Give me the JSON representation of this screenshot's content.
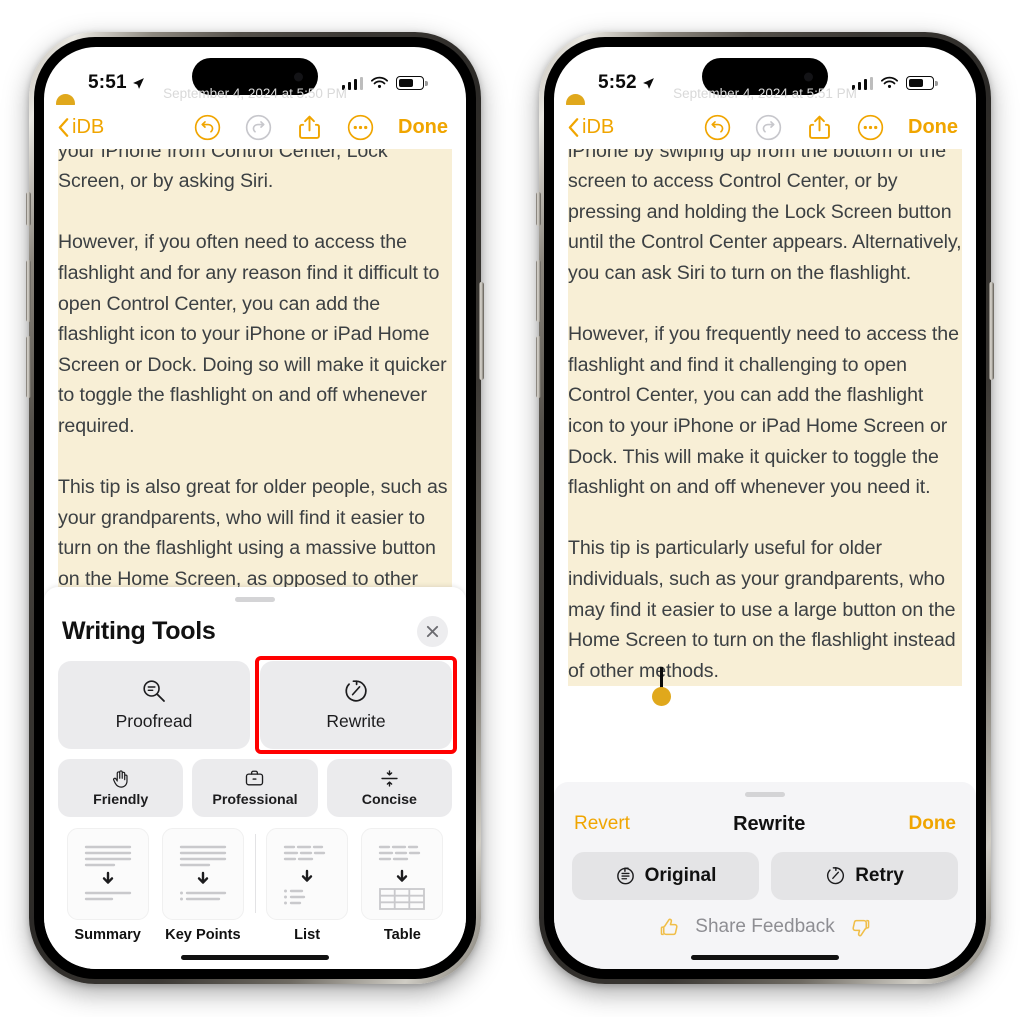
{
  "phones": [
    {
      "id": "left",
      "status": {
        "time": "5:51",
        "location_icon": "location-arrow-icon",
        "cellular_icon": "cellular-signal-icon",
        "wifi_icon": "wifi-icon",
        "battery_icon": "battery-icon"
      },
      "nav": {
        "back_label": "iDB",
        "back_icon": "chevron-left-icon",
        "undo_icon": "undo-icon",
        "redo_icon": "redo-icon",
        "share_icon": "share-icon",
        "more_icon": "more-ellipsis-icon",
        "done_label": "Done"
      },
      "note": {
        "date": "September 4, 2024 at 5:50 PM",
        "paragraphs": [
          "You can easily switch on the flashlight on your iPhone from Control Center, Lock Screen, or by asking Siri.",
          "However, if you often need to access the flashlight and for any reason find it difficult to open Control Center, you can add the flashlight icon to your iPhone or iPad Home Screen or Dock. Doing so will make it quicker to toggle the flashlight on and off whenever required.",
          "This tip is also great for older people, such as your grandparents, who will find it easier to turn on the flashlight using a massive button on the Home Screen, as opposed to other methods."
        ]
      },
      "sheet": {
        "title": "Writing Tools",
        "close_icon": "close-icon",
        "grabber": "sheet-grabber",
        "primary": [
          {
            "label": "Proofread",
            "icon": "proofread-magnifier-icon",
            "highlighted": false
          },
          {
            "label": "Rewrite",
            "icon": "rewrite-clock-icon",
            "highlighted": true
          }
        ],
        "tones": [
          {
            "label": "Friendly",
            "icon": "waving-hand-icon"
          },
          {
            "label": "Professional",
            "icon": "briefcase-icon"
          },
          {
            "label": "Concise",
            "icon": "compress-icon"
          }
        ],
        "formats": [
          {
            "label": "Summary",
            "icon": "summary-doc-icon"
          },
          {
            "label": "Key Points",
            "icon": "key-points-doc-icon"
          },
          {
            "label": "List",
            "icon": "list-doc-icon"
          },
          {
            "label": "Table",
            "icon": "table-doc-icon"
          }
        ]
      }
    },
    {
      "id": "right",
      "status": {
        "time": "5:52",
        "location_icon": "location-arrow-icon",
        "cellular_icon": "cellular-signal-icon",
        "wifi_icon": "wifi-icon",
        "battery_icon": "battery-icon"
      },
      "nav": {
        "back_label": "iDB",
        "back_icon": "chevron-left-icon",
        "undo_icon": "undo-icon",
        "redo_icon": "redo-icon",
        "share_icon": "share-icon",
        "more_icon": "more-ellipsis-icon",
        "done_label": "Done"
      },
      "note": {
        "date": "September 4, 2024 at 5:51 PM",
        "paragraphs": [
          "You can easily turn on the flashlight on your iPhone by swiping up from the bottom of the screen to access Control Center, or by pressing and holding the Lock Screen button until the Control Center appears. Alternatively, you can ask Siri to turn on the flashlight.",
          "However, if you frequently need to access the flashlight and find it challenging to open Control Center, you can add the flashlight icon to your iPhone or iPad Home Screen or Dock. This will make it quicker to toggle the flashlight on and off whenever you need it.",
          "This tip is particularly useful for older individuals, such as your grandparents, who may find it easier to use a large button on the Home Screen to turn on the flashlight instead of other methods."
        ]
      },
      "rewrite_panel": {
        "revert_label": "Revert",
        "title": "Rewrite",
        "done_label": "Done",
        "grabber": "sheet-grabber",
        "buttons": [
          {
            "label": "Original",
            "icon": "original-doc-icon"
          },
          {
            "label": "Retry",
            "icon": "retry-clock-icon"
          }
        ],
        "feedback": {
          "label": "Share Feedback",
          "up_icon": "thumbs-up-icon",
          "down_icon": "thumbs-down-icon"
        }
      }
    }
  ],
  "colors": {
    "accent_yellow": "#F0A500",
    "highlight_ring_red": "#FF0000",
    "text_highlight": "#F8EFD6",
    "selection_handle": "#E0A81C",
    "note_text": "#3c4043",
    "button_grey": "#EBEBED",
    "panel_grey": "#F5F5F7"
  }
}
